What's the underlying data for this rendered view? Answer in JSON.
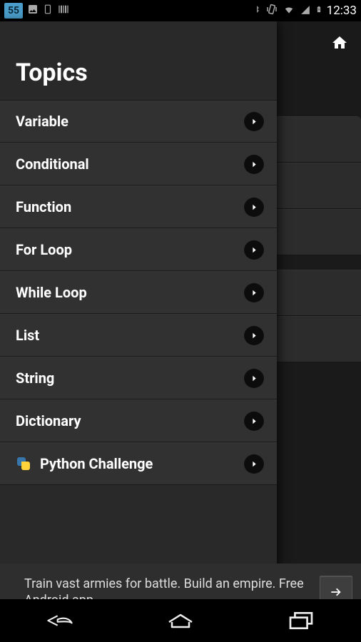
{
  "status": {
    "left_badge": "55",
    "time": "12:33"
  },
  "drawer": {
    "title": "Topics",
    "items": [
      {
        "label": "Variable",
        "icon": null
      },
      {
        "label": "Conditional",
        "icon": null
      },
      {
        "label": "Function",
        "icon": null
      },
      {
        "label": "For Loop",
        "icon": null
      },
      {
        "label": "While Loop",
        "icon": null
      },
      {
        "label": "List",
        "icon": null
      },
      {
        "label": "String",
        "icon": null
      },
      {
        "label": "Dictionary",
        "icon": null
      },
      {
        "label": "Python Challenge",
        "icon": "python"
      }
    ]
  },
  "ad": {
    "text": "Train vast armies for battle. Build an empire. Free Android app."
  }
}
